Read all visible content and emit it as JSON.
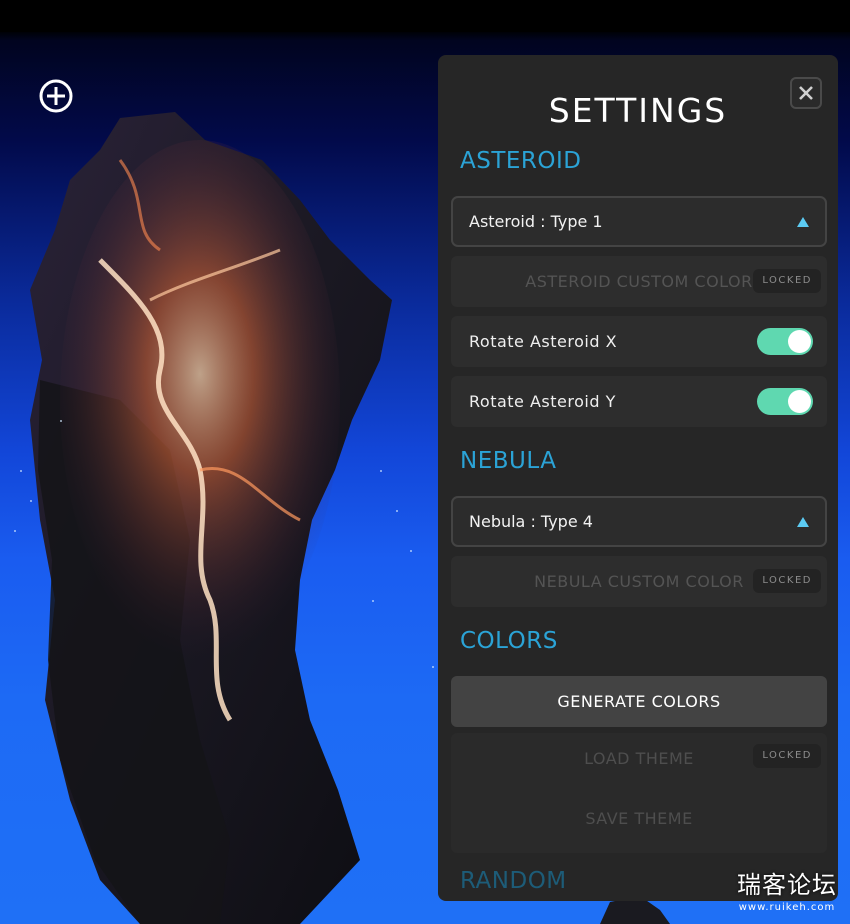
{
  "panel": {
    "title": "SETTINGS",
    "close_icon": "close-icon",
    "background": "#262626",
    "accent": "#2ba3d6",
    "toggle_on_color": "#5fd8b0"
  },
  "asteroid": {
    "heading": "ASTEROID",
    "type_dropdown": {
      "selected": "Asteroid : Type 1"
    },
    "custom_color": {
      "label": "ASTEROID CUSTOM COLOR",
      "badge": "LOCKED"
    },
    "rotate_x": {
      "label": "Rotate Asteroid X",
      "on": true
    },
    "rotate_y": {
      "label": "Rotate Asteroid Y",
      "on": true
    }
  },
  "nebula": {
    "heading": "NEBULA",
    "type_dropdown": {
      "selected": "Nebula : Type 4"
    },
    "custom_color": {
      "label": "NEBULA CUSTOM COLOR",
      "badge": "LOCKED"
    }
  },
  "colors": {
    "heading": "COLORS",
    "generate_label": "GENERATE COLORS",
    "load_theme_label": "LOAD THEME",
    "load_theme_badge": "LOCKED",
    "save_theme_label": "SAVE THEME"
  },
  "random": {
    "heading": "RANDOM"
  },
  "scene": {
    "add_icon": "add-circle-icon"
  },
  "watermark": {
    "text": "瑞客论坛",
    "url": "www.ruikeh.com"
  }
}
